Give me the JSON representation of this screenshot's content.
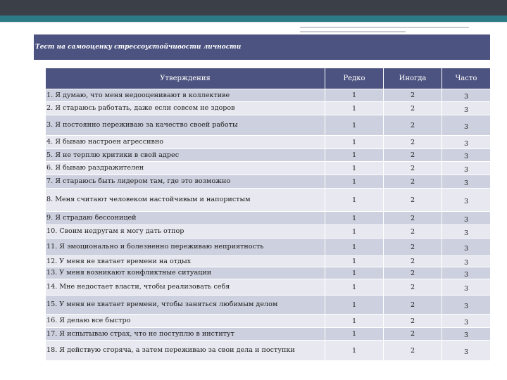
{
  "title": "Тест на самооценку стрессоустойчивости личности",
  "headers": [
    "Утверждения",
    "Редко",
    "Иногда",
    "Часто"
  ],
  "rows": [
    [
      "1. Я думаю, что меня недооценивают в коллективе",
      "1",
      "2",
      "3"
    ],
    [
      "2. Я стараюсь работать, даже если совсем не здоров",
      "1",
      "2",
      "3"
    ],
    [
      "3. Я постоянно переживаю за качество своей работы",
      "1",
      "2",
      "3"
    ],
    [
      "4. Я бываю настроен агрессивно",
      "1",
      "2",
      "3"
    ],
    [
      "5. Я не терплю критики в свой адрес",
      "1",
      "2",
      "3"
    ],
    [
      "6. Я бываю раздражителен",
      "1",
      "2",
      "3"
    ],
    [
      "7. Я стараюсь быть лидером там, где это возможно",
      "1",
      "2",
      "3"
    ],
    [
      "8. Меня считают человеком настойчивым и напористым",
      "1",
      "2",
      "3"
    ],
    [
      "9. Я страдаю бессоницей",
      "1",
      "2",
      "3"
    ],
    [
      "10. Своим недругам я могу дать отпор",
      "1",
      "2",
      "3"
    ],
    [
      "11. Я эмоционально и болезненно переживаю неприятность",
      "1",
      "2",
      "3"
    ],
    [
      "12. У меня не хватает времени на отдых",
      "1",
      "2",
      "3"
    ],
    [
      "13. У меня возникают конфликтные ситуации",
      "1",
      "2",
      "3"
    ],
    [
      "14. Мне недостает власти, чтобы реализовать себя",
      "1",
      "2",
      "3"
    ],
    [
      "15. У меня не хватает времени, чтобы заняться любимым делом",
      "1",
      "2",
      "3"
    ],
    [
      "16. Я делаю все быстро",
      "1",
      "2",
      "3"
    ],
    [
      "17. Я испытываю страх, что не поступлю в институт",
      "1",
      "2",
      "3"
    ],
    [
      "18. Я действую сгоряча, а затем переживаю за свои дела и поступки",
      "1",
      "2",
      "3"
    ]
  ]
}
